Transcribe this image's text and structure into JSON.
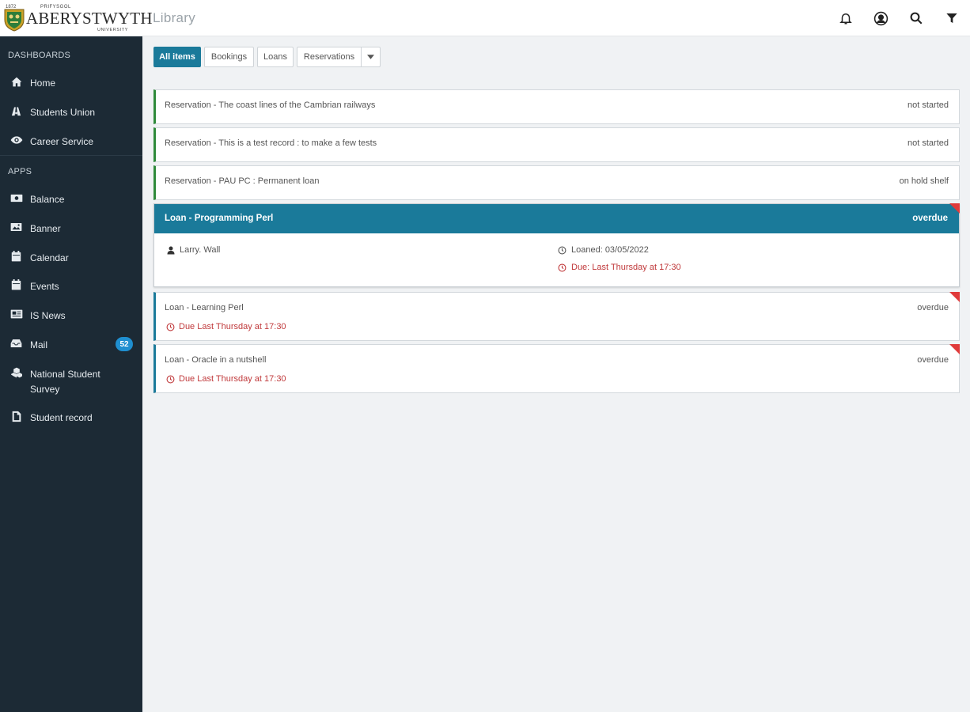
{
  "header": {
    "logo": {
      "year": "1872",
      "welsh": "PRIFYSGOL",
      "wordmark": "ABERYSTWYTH",
      "sub": "UNIVERSITY"
    },
    "app_title": "Library",
    "icons": [
      "bell-icon",
      "user-circle-icon",
      "search-icon",
      "filter-icon"
    ]
  },
  "sidebar": {
    "dashboards_label": "DASHBOARDS",
    "apps_label": "APPS",
    "dashboards": [
      {
        "label": "Home",
        "icon": "home-icon"
      },
      {
        "label": "Students Union",
        "icon": "students-union-icon"
      },
      {
        "label": "Career Service",
        "icon": "eye-icon"
      }
    ],
    "apps": [
      {
        "label": "Balance",
        "icon": "money-icon"
      },
      {
        "label": "Banner",
        "icon": "image-icon"
      },
      {
        "label": "Calendar",
        "icon": "calendar-icon"
      },
      {
        "label": "Events",
        "icon": "calendar-icon"
      },
      {
        "label": "IS News",
        "icon": "newspaper-icon"
      },
      {
        "label": "Mail",
        "icon": "inbox-icon",
        "badge": "52"
      },
      {
        "label": "National Student Survey",
        "icon": "cubes-icon"
      },
      {
        "label": "Student record",
        "icon": "file-icon"
      }
    ]
  },
  "tabs": {
    "all": "All items",
    "bookings": "Bookings",
    "loans": "Loans",
    "reservations": "Reservations"
  },
  "items": [
    {
      "title": "Reservation - The coast lines of the Cambrian railways",
      "status": "not started"
    },
    {
      "title": "Reservation - This is a test record : to make a few tests",
      "status": "not started"
    },
    {
      "title": "Reservation - PAU PC : Permanent loan",
      "status": "on hold shelf"
    }
  ],
  "expanded": {
    "title": "Loan - Programming Perl",
    "status": "overdue",
    "author": "Larry. Wall",
    "loaned": "Loaned: 03/05/2022",
    "due": "Due: Last Thursday at 17:30"
  },
  "loans": [
    {
      "title": "Loan - Learning Perl",
      "status": "overdue",
      "due": "Due Last Thursday at 17:30"
    },
    {
      "title": "Loan - Oracle in a nutshell",
      "status": "overdue",
      "due": "Due Last Thursday at 17:30"
    }
  ],
  "colors": {
    "accent": "#1a7a9a",
    "sidebar": "#1c2a35",
    "reservation_border": "#2f8a3b",
    "overdue_red": "#c0393b",
    "badge": "#1f8fd0"
  }
}
